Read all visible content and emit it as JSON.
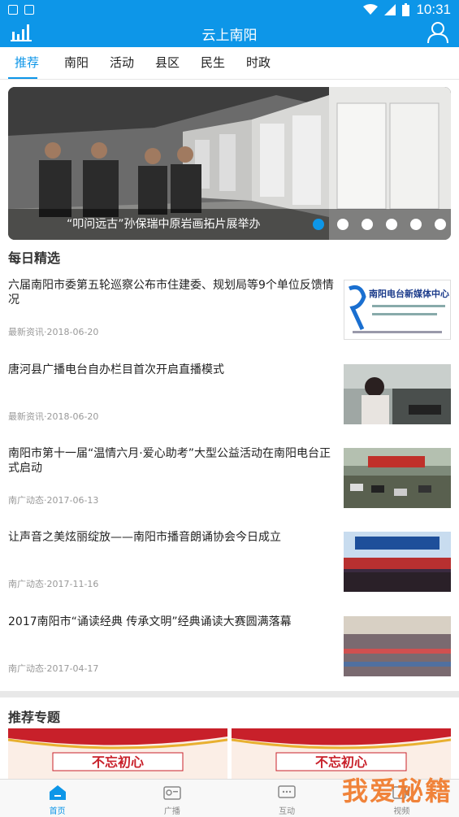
{
  "status_bar": {
    "time": "10:31"
  },
  "app": {
    "title": "云上南阳"
  },
  "tabs": [
    {
      "label": "推荐"
    },
    {
      "label": "南阳"
    },
    {
      "label": "活动"
    },
    {
      "label": "县区"
    },
    {
      "label": "民生"
    },
    {
      "label": "时政"
    }
  ],
  "banner": {
    "caption": "“叩问远古”孙保瑞中原岩画拓片展举办",
    "slide_count": 6,
    "active_slide": 1
  },
  "daily": {
    "title": "每日精选",
    "items": [
      {
        "title": "六届南阳市委第五轮巡察公布市住建委、规划局等9个单位反馈情况",
        "meta": "最新资讯·2018-06-20",
        "thumb": "logo-card",
        "logo_text": "南阳电台新媒体中心"
      },
      {
        "title": "唐河县广播电台自办栏目首次开启直播模式",
        "meta": "最新资讯·2018-06-20",
        "thumb": "studio"
      },
      {
        "title": "南阳市第十一届“温情六月·爱心助考”大型公益活动在南阳电台正式启动",
        "meta": "南广动态·2017-06-13",
        "thumb": "crowd-outdoor"
      },
      {
        "title": "让声音之美炫丽绽放——南阳市播音朗诵协会今日成立",
        "meta": "南广动态·2017-11-16",
        "thumb": "stage"
      },
      {
        "title": "2017南阳市“诵读经典 传承文明”经典诵读大赛圆满落幕",
        "meta": "南广动态·2017-04-17",
        "thumb": "auditorium"
      }
    ]
  },
  "topics": {
    "title": "推荐专题",
    "cards": [
      {
        "text": "不忘初心"
      },
      {
        "text": "不忘初心"
      }
    ]
  },
  "bottom_nav": [
    {
      "label": "首页",
      "icon": "home-icon",
      "active": true
    },
    {
      "label": "广播",
      "icon": "radio-icon",
      "active": false
    },
    {
      "label": "互动",
      "icon": "chat-icon",
      "active": false
    },
    {
      "label": "视频",
      "icon": "video-icon",
      "active": false
    }
  ],
  "watermark": {
    "text": "我爱秘籍"
  },
  "colors": {
    "primary": "#0d96e8",
    "watermark": "#f07a2a"
  }
}
